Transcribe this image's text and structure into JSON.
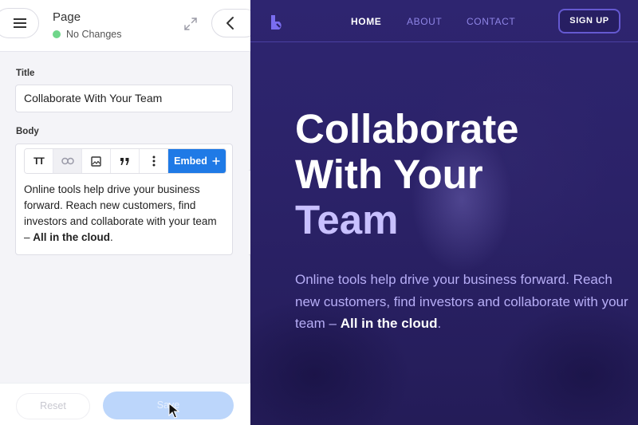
{
  "editor": {
    "header": {
      "title": "Page",
      "status": "No Changes",
      "status_color": "#6fd68a"
    },
    "title_field": {
      "label": "Title",
      "value": "Collaborate With Your Team"
    },
    "body_field": {
      "label": "Body",
      "toolbar": {
        "text_size_icon": "TT",
        "link_icon": "link-icon",
        "image_icon": "image-icon",
        "quote_icon": "quote-icon",
        "more_icon": "more-vertical-icon",
        "embed_label": "Embed",
        "embed_color": "#1f7ae6"
      },
      "content_plain": "Online tools help drive your business forward. Reach new customers, find investors and collaborate with your team – ",
      "content_bold": "All in the cloud",
      "content_end": "."
    },
    "footer": {
      "reset_label": "Reset",
      "save_label": "Save"
    }
  },
  "preview": {
    "nav": {
      "links": [
        "HOME",
        "ABOUT",
        "CONTACT"
      ],
      "active_link": "HOME",
      "signup_label": "SIGN UP"
    },
    "hero": {
      "title_lines": [
        "Collaborate",
        "With Your",
        "Team"
      ],
      "text_plain": "Online tools help drive your business forward. Reach new customers, find investors and collaborate with your team – ",
      "text_bold": "All in the cloud",
      "text_end": "."
    },
    "colors": {
      "background": "#2a2166",
      "accent": "#6559d1",
      "text_muted": "#b7aef6"
    }
  }
}
